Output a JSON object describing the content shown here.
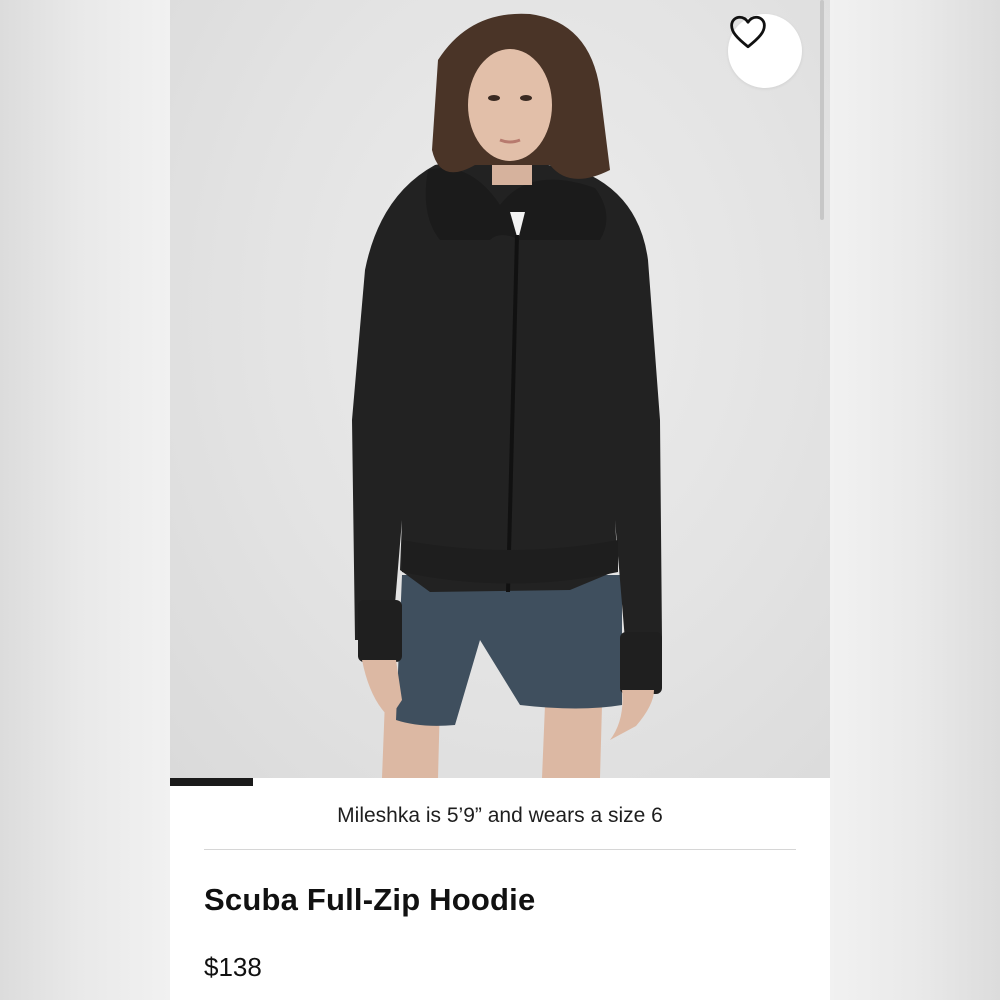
{
  "product": {
    "model_caption": "Mileshka is 5’9” and wears a size 6",
    "name": "Scuba Full-Zip Hoodie",
    "price": "$138"
  },
  "gallery": {
    "image_index_progress": 0.125,
    "favorite_icon": "heart-outline-icon"
  },
  "colors": {
    "background": "#ffffff",
    "text": "#111111",
    "progress": "#1a1a1a",
    "hoodie": "#222222",
    "shorts": "#3f4f5e"
  }
}
